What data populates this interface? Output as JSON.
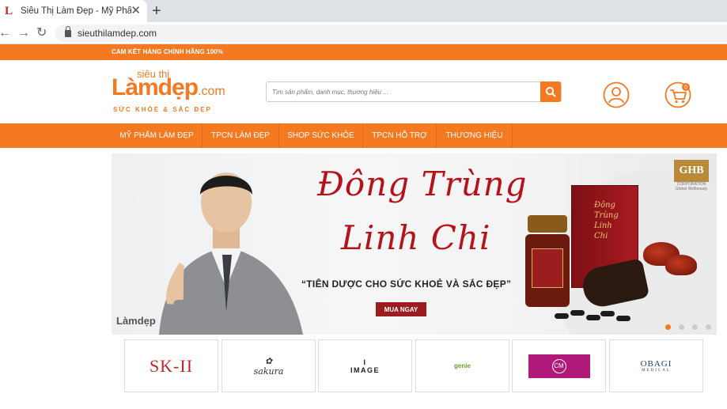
{
  "browser": {
    "tab_title": "Siêu Thị Làm Đẹp - Mỹ Phẩm & T",
    "tab_favicon": "L",
    "new_tab": "+",
    "url": "sieuthilamdep.com"
  },
  "promo": {
    "text": "CAM KẾT HÀNG CHÍNH HÃNG 100%"
  },
  "logo": {
    "top": "siêu thị",
    "main": "Làmdẹp",
    "suffix": ".com",
    "tagline": "SỨC KHỎE & SẮC ĐẸP"
  },
  "search": {
    "placeholder": "Tìm sản phẩm, danh mục, thương hiệu ..."
  },
  "cart": {
    "count": "0"
  },
  "nav": {
    "items": [
      "MỸ PHẨM LÀM ĐẸP",
      "TPCN LÀM ĐẸP",
      "SHOP SỨC KHỎE",
      "TPCN HỖ TRỢ",
      "THƯƠNG HIỆU"
    ]
  },
  "banner": {
    "title_line1": "Đông Trùng",
    "title_line2": "Linh Chi",
    "tagline": "“TIÊN DƯỢC CHO SỨC KHOẺ VÀ SẮC ĐẸP”",
    "cta": "MUA NGAY",
    "small_logo": "Làmdẹp",
    "ghb": "GHB",
    "ghb_sub": "CORPORATION Global Wellbeauty",
    "box_text": "Đông Trùng Linh Chi"
  },
  "brands": {
    "skii": "SK-II",
    "sakura": "sakura",
    "image": "IMAGE",
    "genie": "genie",
    "cm": "CM",
    "obagi": "OBAGI",
    "obagi_sub": "MEDICAL"
  },
  "colors": {
    "accent": "#f47920",
    "banner_red": "#b5121b",
    "cta": "#9b1d20"
  }
}
